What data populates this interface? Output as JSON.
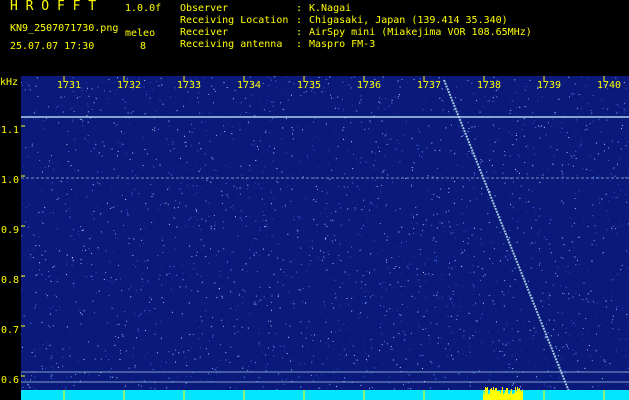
{
  "header": {
    "brand": "H R O F F T",
    "version": "1.0.0f",
    "filename": "KN9_2507071730.png",
    "meleo_label": "meleo",
    "meleo_value": "8",
    "timestamp": "25.07.07 17:30",
    "info": [
      {
        "label": "Observer",
        "value": "K.Nagai"
      },
      {
        "label": "Receiving Location",
        "value": "Chigasaki, Japan (139.414 35.340)"
      },
      {
        "label": "Receiver",
        "value": "AirSpy mini (Miakejima VOR 108.65MHz)"
      },
      {
        "label": "Receiving antenna",
        "value": "Maspro FM-3"
      }
    ],
    "separator": ":"
  },
  "axes": {
    "y_unit": "kHz",
    "y_ticks": [
      "1.1",
      "1.0",
      "0.9",
      "0.8",
      "0.7",
      "0.6"
    ],
    "x_ticks": [
      "1731",
      "1732",
      "1733",
      "1734",
      "1735",
      "1736",
      "1737",
      "1738",
      "1739",
      "1740"
    ]
  },
  "colors": {
    "background": "#000000",
    "label": "#ffff00",
    "waterfall": "#0b1a7a",
    "signal": "#c8f4ff",
    "baseline": "#00e6ff",
    "burst": "#ffff00"
  }
}
